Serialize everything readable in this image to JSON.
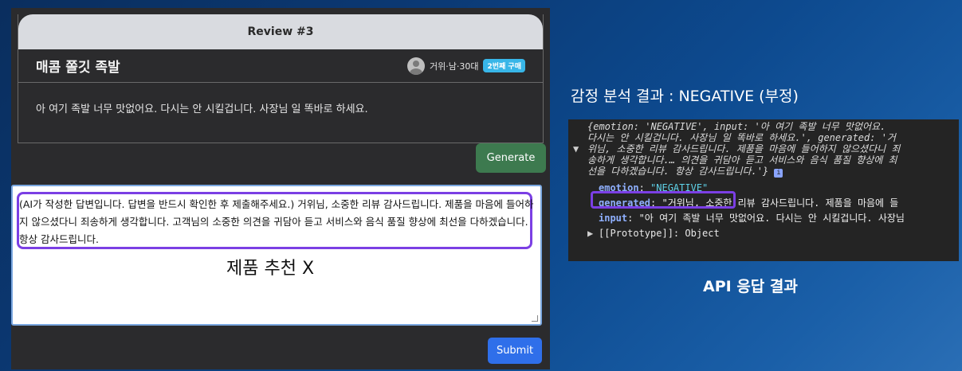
{
  "card": {
    "title": "Review #3",
    "product_name": "매콤 쫄깃 족발",
    "reviewer": "거위·남·30대",
    "badge": "2번째 구매",
    "review_text": "아 여기 족발 너무 맛없어요. 다시는 안 시킬겁니다. 사장님 일 똑바로 하세요."
  },
  "buttons": {
    "generate": "Generate",
    "submit": "Submit"
  },
  "answer": {
    "text": "(AI가 작성한 답변입니다. 답변을 반드시 확인한 후 제출해주세요.) 거위님, 소중한 리뷰 감사드립니다. 제품을 마음에 들어하지 않으셨다니 죄송하게 생각합니다. 고객님의 소중한 의견을 귀담아 듣고 서비스와 음식 품질 향상에 최선을 다하겠습니다. 항상 감사드립니다.",
    "annotation": "제품 추천 X"
  },
  "right": {
    "title": "감정 분석 결과 : NEGATIVE (부정)",
    "caption": "API 응답 결과"
  },
  "console": {
    "l1": "{emotion: 'NEGATIVE', input: '아 여기 족발 너무 맛없어요.",
    "l2": "다시는 안 시킬겁니다. 사장님 일 똑바로 하세요.', generated: '거",
    "l3": "위님, 소중한 리뷰 감사드립니다. 제품을 마음에 들어하지 않으셨다니 죄",
    "l4": "송하게 생각합니다.… 의견을 귀담아 듣고 서비스와 음식 품질 향상에 최",
    "l5": "선을 다하겠습니다. 항상 감사드립니다.'}",
    "emotion_key": "emotion",
    "emotion_val": "\"NEGATIVE\"",
    "generated_key": "generated",
    "generated_val": "\"거위님, 소중한 리뷰 감사드립니다. 제품을 마음에 들",
    "input_key": "input",
    "input_val": "\"아 여기 족발 너무 맛없어요. 다시는 안 시킬겁니다. 사장님",
    "prototype": "[[Prototype]]: Object"
  }
}
